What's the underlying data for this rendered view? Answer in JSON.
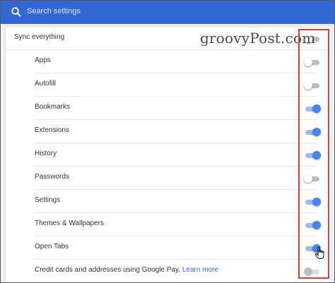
{
  "search": {
    "placeholder": "Search settings",
    "icon": "search-icon"
  },
  "watermark": "groovyPost.com",
  "colors": {
    "accent": "#3367d6",
    "toggle_on": "#4285f4",
    "toggle_on_track": "#9fbaf0",
    "highlight": "#e53935"
  },
  "sync_items": [
    {
      "label": "Sync everything",
      "on": false,
      "level": 0
    },
    {
      "label": "Apps",
      "on": false,
      "level": 1
    },
    {
      "label": "Autofill",
      "on": false,
      "level": 1
    },
    {
      "label": "Bookmarks",
      "on": true,
      "level": 1
    },
    {
      "label": "Extensions",
      "on": true,
      "level": 1
    },
    {
      "label": "History",
      "on": true,
      "level": 1
    },
    {
      "label": "Passwords",
      "on": false,
      "level": 1
    },
    {
      "label": "Settings",
      "on": true,
      "level": 1
    },
    {
      "label": "Themes & Wallpapers",
      "on": true,
      "level": 1
    },
    {
      "label": "Open Tabs",
      "on": true,
      "level": 1
    },
    {
      "label": "Credit cards and addresses using Google Pay.",
      "link": "Learn more",
      "on": false,
      "disabled": true,
      "level": 1
    }
  ],
  "cursor": "hand-pointer-icon"
}
